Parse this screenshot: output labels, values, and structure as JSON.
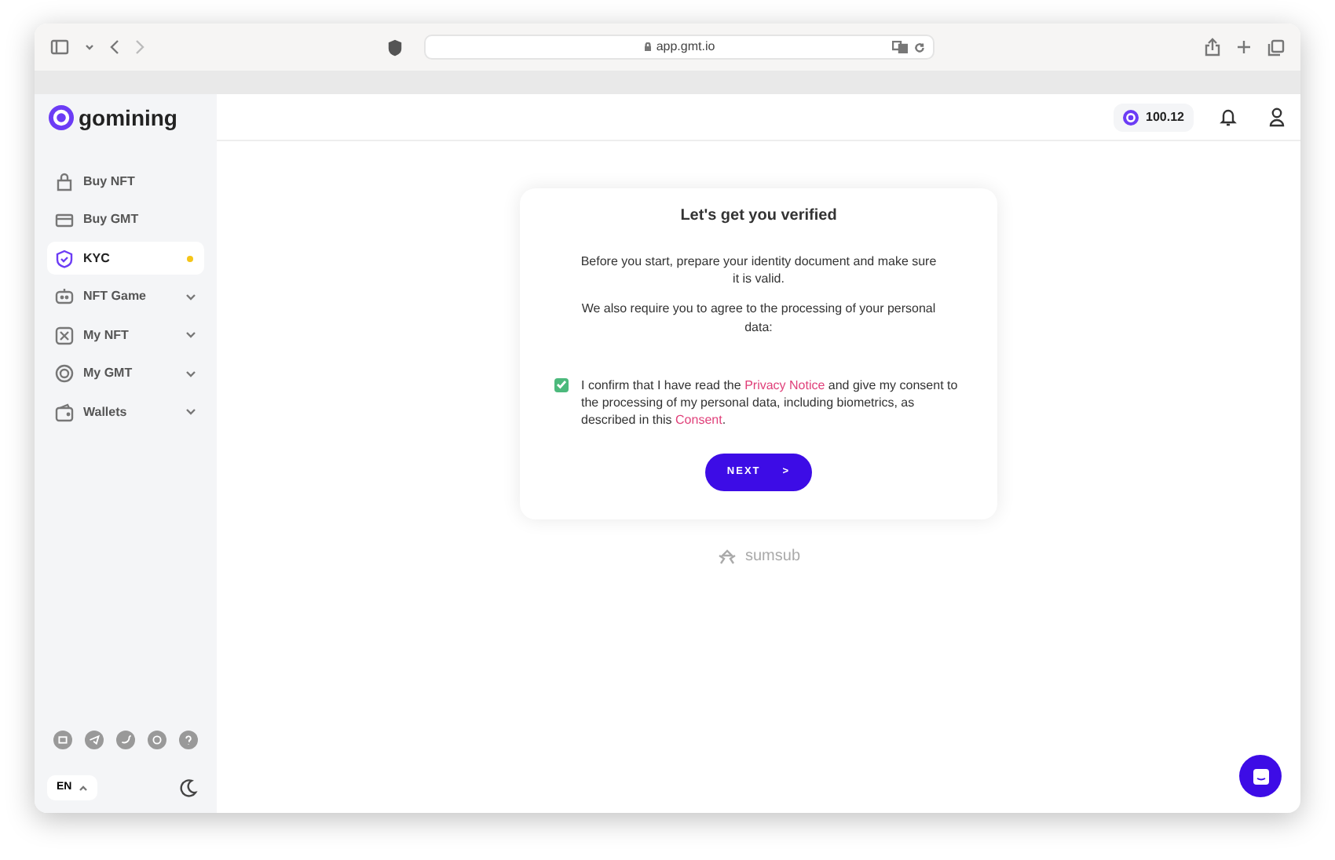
{
  "browser": {
    "url": "app.gmt.io"
  },
  "sidebar": {
    "logo": "gomining",
    "items": [
      {
        "label": "Buy NFT",
        "selected": false,
        "expandable": false,
        "alert": false
      },
      {
        "label": "Buy GMT",
        "selected": false,
        "expandable": false,
        "alert": false
      },
      {
        "label": "KYC",
        "selected": true,
        "expandable": false,
        "alert": true
      },
      {
        "label": "NFT Game",
        "selected": false,
        "expandable": true,
        "alert": false
      },
      {
        "label": "My NFT",
        "selected": false,
        "expandable": true,
        "alert": false
      },
      {
        "label": "My GMT",
        "selected": false,
        "expandable": true,
        "alert": false
      },
      {
        "label": "Wallets",
        "selected": false,
        "expandable": true,
        "alert": false
      }
    ],
    "language": "EN"
  },
  "header": {
    "balance": "100.12"
  },
  "card": {
    "title": "Let's get you verified",
    "paragraphs": [
      "Before you start, prepare your identity document and make sure it is valid.",
      "We also require you to agree to the processing of your personal data:"
    ],
    "consent": {
      "checked": true,
      "parts": [
        {
          "kind": "text",
          "text": "I confirm that I have read the "
        },
        {
          "kind": "link",
          "text": "Privacy Notice"
        },
        {
          "kind": "text",
          "text": " and give my consent to the processing of my personal data, including biometrics, as described in this "
        },
        {
          "kind": "link",
          "text": "Consent"
        },
        {
          "kind": "text",
          "text": "."
        }
      ]
    },
    "button": {
      "label": "NEXT",
      "arrow": ">"
    }
  },
  "footer": {
    "brand": "sumsub"
  }
}
